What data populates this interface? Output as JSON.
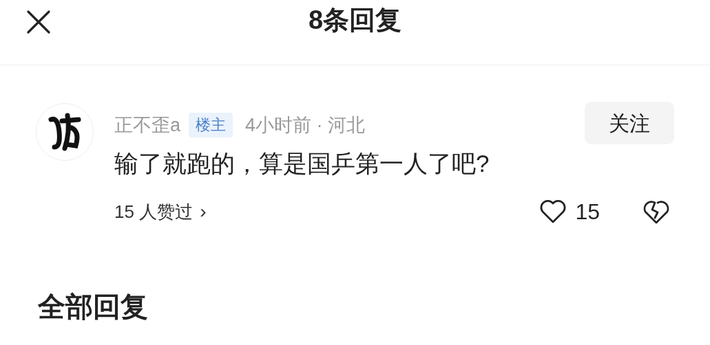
{
  "header": {
    "title": "8条回复"
  },
  "comment": {
    "author": "正不歪a",
    "badge": "楼主",
    "meta": "4小时前 · 河北",
    "follow": "关注",
    "text": "输了就跑的，算是国乒第一人了吧?",
    "likers": "15 人赞过",
    "liker_arrow": "›",
    "likes": "15",
    "liked": false
  },
  "section": {
    "title": "全部回复"
  }
}
